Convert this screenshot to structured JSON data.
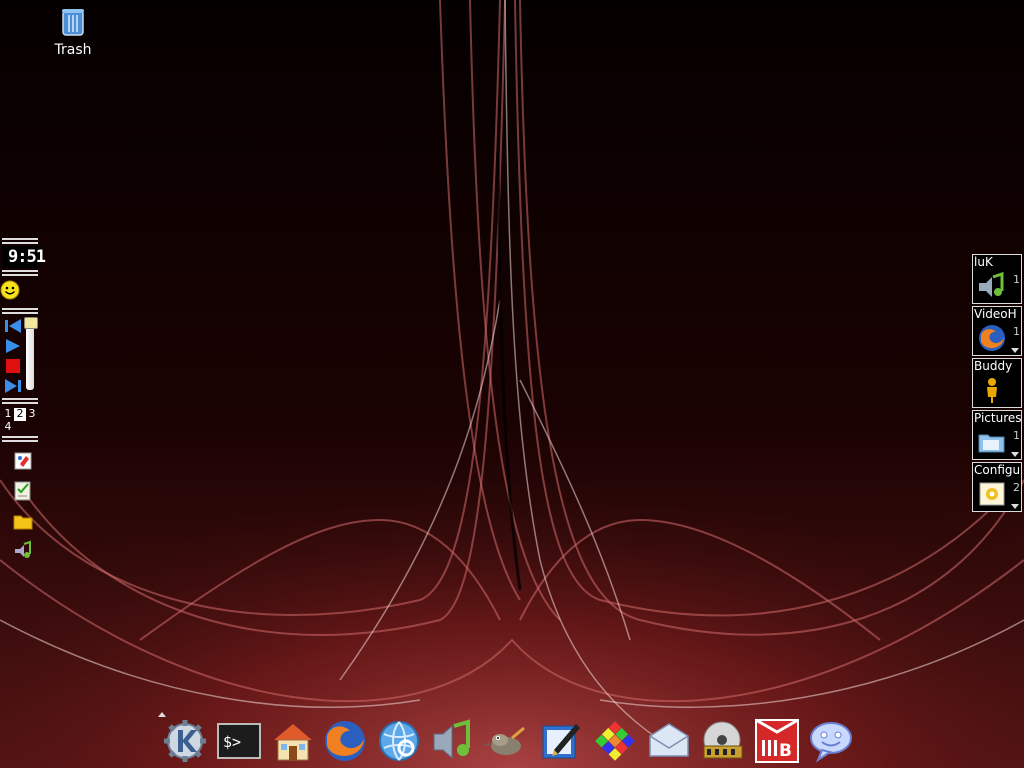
{
  "desktop": {
    "trash_label": "Trash"
  },
  "left_panel": {
    "clock": "9:51",
    "pager": [
      "1",
      "2",
      "3",
      "4"
    ],
    "active_desktop": "2",
    "media_controls": [
      "previous-icon",
      "play-icon",
      "stop-icon",
      "next-icon"
    ],
    "quick_launch": [
      "kpaint-icon",
      "checklist-icon",
      "folder-icon",
      "music-icon"
    ]
  },
  "taskbar": {
    "items": [
      {
        "title": "luK",
        "number": "1",
        "icon": "music-player-icon"
      },
      {
        "title": "VideoH",
        "number": "1",
        "icon": "firefox-icon"
      },
      {
        "title": "Buddy",
        "number": "",
        "icon": "buddy-icon"
      },
      {
        "title": "Pictures",
        "number": "1",
        "icon": "folder-icon"
      },
      {
        "title": "Configu",
        "number": "2",
        "icon": "config-icon"
      }
    ]
  },
  "dock": {
    "items": [
      "kde-menu-icon",
      "terminal-icon",
      "home-icon",
      "firefox-icon",
      "network-icon",
      "music-icon",
      "gimp-icon",
      "editor-icon",
      "rubik-icon",
      "mail-icon",
      "media-player-icon",
      "office-icon",
      "chat-icon"
    ]
  },
  "colors": {
    "background": "#0a0000",
    "accent_red": "#c63c3c"
  }
}
